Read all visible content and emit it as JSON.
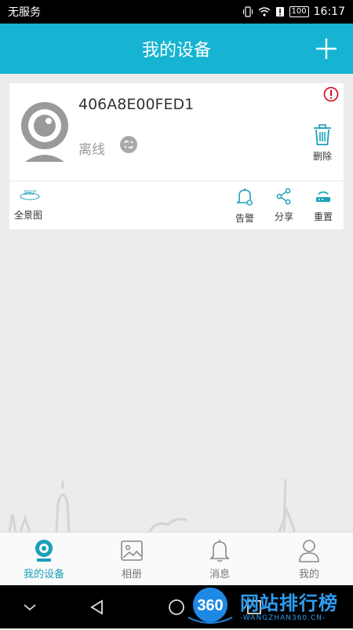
{
  "status_bar": {
    "carrier": "无服务",
    "battery": "100",
    "time": "16:17"
  },
  "header": {
    "title": "我的设备"
  },
  "device_card": {
    "device_id": "406A8E00FED1",
    "status": "离线",
    "delete_label": "删除",
    "actions": {
      "panorama_label": "全景图",
      "panorama_badge": "360°",
      "alarm_label": "告警",
      "share_label": "分享",
      "reset_label": "重置"
    }
  },
  "bottom_nav": {
    "items": [
      {
        "label": "我的设备",
        "active": true
      },
      {
        "label": "相册",
        "active": false
      },
      {
        "label": "消息",
        "active": false
      },
      {
        "label": "我的",
        "active": false
      }
    ]
  },
  "watermark": {
    "text": "网站排行榜",
    "subtext": "-WANGZHAN360.CN-",
    "badge": "360"
  },
  "colors": {
    "accent": "#16b4d2",
    "active_nav": "#1aa0b8",
    "alert": "#d0021b"
  }
}
